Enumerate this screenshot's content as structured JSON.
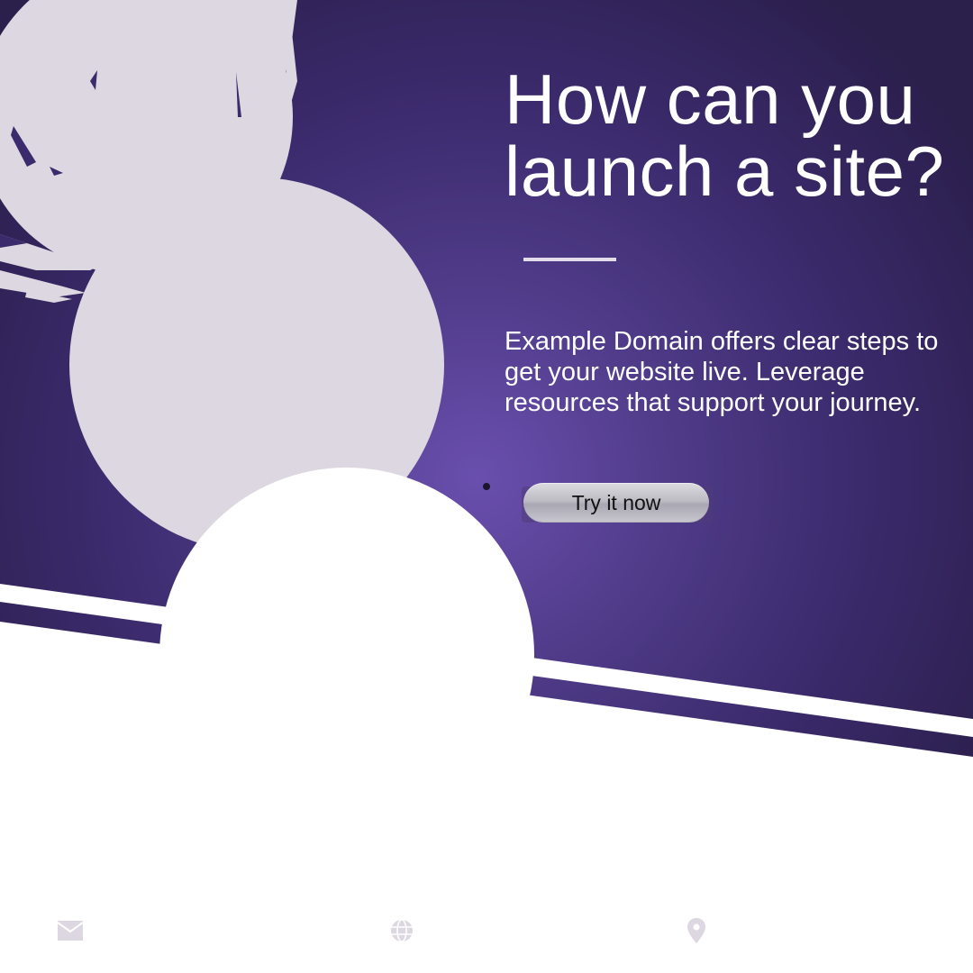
{
  "hero": {
    "headline": "How can you launch a site?",
    "description": "Example Domain offers clear steps to get your website live. Leverage resources that support your journey.",
    "cta_label": "Try it now"
  },
  "colors": {
    "background_gradient_center": "#6a4fae",
    "background_gradient_edge": "#2b1f4c",
    "circle_light": "#dcd7e0",
    "divider": "#e3dcea",
    "footer_icon": "#dcd7e0"
  },
  "footer": {
    "icons": [
      "mail-icon",
      "globe-icon",
      "location-pin-icon"
    ]
  }
}
